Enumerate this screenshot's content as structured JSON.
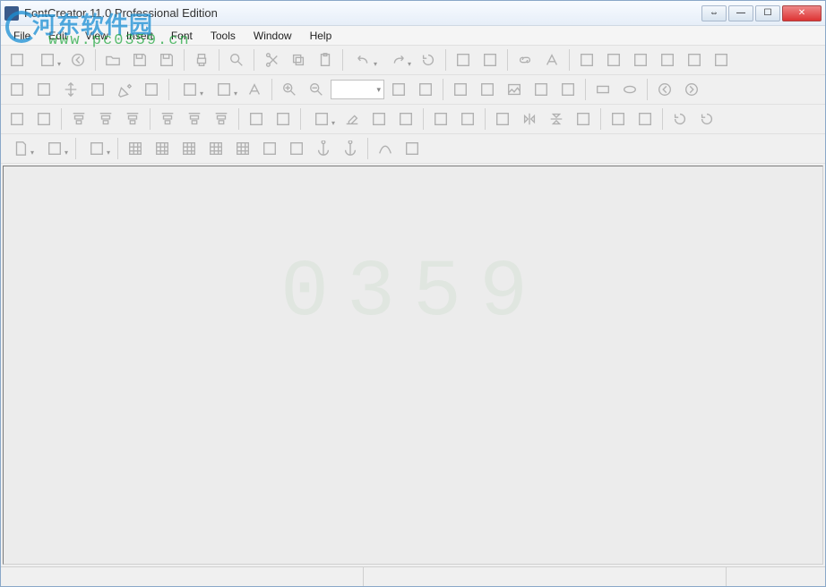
{
  "title": "FontCreator 11.0 Professional Edition",
  "menus": [
    "File",
    "Edit",
    "View",
    "Insert",
    "Font",
    "Tools",
    "Window",
    "Help"
  ],
  "watermark": {
    "brand": "河东软件园",
    "url": "www.pc0359.cn",
    "center": "0359"
  },
  "toolbar1": [
    {
      "n": "new-font-icon"
    },
    {
      "n": "new-glyph-icon",
      "dd": true
    },
    {
      "n": "preview-aa-icon"
    },
    {
      "sep": true
    },
    {
      "n": "open-icon"
    },
    {
      "n": "save-icon"
    },
    {
      "n": "save-all-icon"
    },
    {
      "sep": true
    },
    {
      "n": "print-icon"
    },
    {
      "sep": true
    },
    {
      "n": "find-icon"
    },
    {
      "sep": true
    },
    {
      "n": "cut-icon"
    },
    {
      "n": "copy-icon"
    },
    {
      "n": "paste-icon"
    },
    {
      "sep": true
    },
    {
      "n": "undo-icon",
      "dd": true
    },
    {
      "n": "redo-icon",
      "dd": true
    },
    {
      "n": "refresh-icon"
    },
    {
      "sep": true
    },
    {
      "n": "add-char-icon"
    },
    {
      "n": "add-glyph-icon"
    },
    {
      "sep": true
    },
    {
      "n": "link-icon"
    },
    {
      "n": "text-tool-icon"
    },
    {
      "sep": true
    },
    {
      "n": "properties-icon"
    },
    {
      "n": "settings-icon"
    },
    {
      "n": "validate-icon"
    },
    {
      "n": "compare-icon"
    },
    {
      "n": "spellcheck-icon"
    },
    {
      "n": "test-icon"
    }
  ],
  "toolbar2": [
    {
      "n": "select-rect-icon"
    },
    {
      "n": "lasso-icon"
    },
    {
      "n": "pan-icon"
    },
    {
      "n": "measure-icon"
    },
    {
      "n": "pen-icon"
    },
    {
      "n": "freehand-icon"
    },
    {
      "sep": true
    },
    {
      "n": "contour-icon",
      "dd": true
    },
    {
      "n": "fill-icon",
      "dd": true
    },
    {
      "n": "glyph-a-icon"
    },
    {
      "sep": true
    },
    {
      "n": "zoom-in-icon"
    },
    {
      "n": "zoom-out-icon"
    },
    {
      "combo": "zoom",
      "v": ""
    },
    {
      "n": "fit-icon"
    },
    {
      "n": "actual-icon"
    },
    {
      "sep": true
    },
    {
      "n": "knife-icon"
    },
    {
      "n": "slice-icon"
    },
    {
      "n": "image-icon"
    },
    {
      "n": "brush-icon"
    },
    {
      "n": "eyedrop-icon"
    },
    {
      "sep": true
    },
    {
      "n": "rect-shape-icon"
    },
    {
      "n": "ellipse-icon"
    },
    {
      "sep": true
    },
    {
      "n": "prev-icon"
    },
    {
      "n": "next-icon"
    }
  ],
  "toolbar3": [
    {
      "n": "union-icon"
    },
    {
      "n": "subtract-icon"
    },
    {
      "sep": true
    },
    {
      "n": "align-left-icon"
    },
    {
      "n": "align-center-icon"
    },
    {
      "n": "align-right-icon"
    },
    {
      "sep": true
    },
    {
      "n": "align-top-icon"
    },
    {
      "n": "align-middle-icon"
    },
    {
      "n": "align-bottom-icon"
    },
    {
      "sep": true
    },
    {
      "n": "distribute-h-icon"
    },
    {
      "n": "distribute-v-icon"
    },
    {
      "sep": true
    },
    {
      "n": "clipboard-icon",
      "dd": true
    },
    {
      "n": "erase-icon"
    },
    {
      "n": "smooth-icon"
    },
    {
      "n": "guide-g-icon"
    },
    {
      "sep": true
    },
    {
      "n": "snap-icon"
    },
    {
      "n": "trim-icon"
    },
    {
      "sep": true
    },
    {
      "n": "flip-left-icon"
    },
    {
      "n": "flip-h-icon"
    },
    {
      "n": "flip-v-icon"
    },
    {
      "n": "flip-right-icon"
    },
    {
      "sep": true
    },
    {
      "n": "transform-icon"
    },
    {
      "n": "scale-icon"
    },
    {
      "sep": true
    },
    {
      "n": "rotate-cw-icon"
    },
    {
      "n": "rotate-ccw-icon"
    }
  ],
  "toolbar4": [
    {
      "n": "page-icon",
      "dd": true
    },
    {
      "n": "metrics-icon",
      "dd": true
    },
    {
      "sep": true
    },
    {
      "n": "export-icon",
      "dd": true
    },
    {
      "sep": true
    },
    {
      "n": "grid1-icon"
    },
    {
      "n": "grid2-icon"
    },
    {
      "n": "grid3-icon"
    },
    {
      "n": "grid4-icon"
    },
    {
      "n": "lock-grid-icon"
    },
    {
      "n": "guides-icon"
    },
    {
      "n": "lock-guides-icon"
    },
    {
      "n": "anchor-icon"
    },
    {
      "n": "lock-anchor-icon"
    },
    {
      "sep": true
    },
    {
      "n": "curve-icon"
    },
    {
      "n": "kerning-icon"
    }
  ],
  "status": [
    "",
    "",
    ""
  ]
}
